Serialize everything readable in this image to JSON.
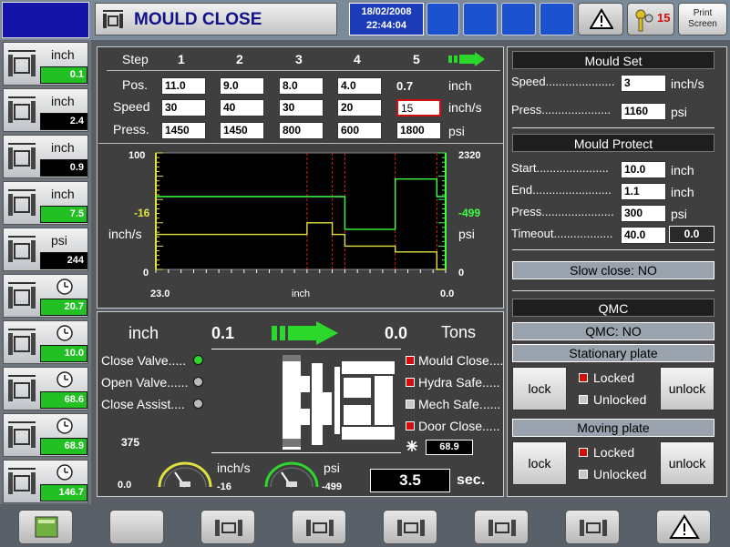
{
  "header": {
    "title": "MOULD CLOSE",
    "date": "18/02/2008",
    "time": "22:44:04",
    "alarm_count": "15",
    "print_label_1": "Print",
    "print_label_2": "Screen"
  },
  "sidebar": [
    {
      "unit": "inch",
      "value": "0.1",
      "color": "#22c022",
      "icon": "clamp-open-icon"
    },
    {
      "unit": "inch",
      "value": "2.4",
      "color": "#000000",
      "icon": "injection-unit-icon"
    },
    {
      "unit": "inch",
      "value": "0.9",
      "color": "#000000",
      "icon": "nozzle-icon"
    },
    {
      "unit": "inch",
      "value": "7.5",
      "color": "#22c022",
      "icon": "screw-back-icon"
    },
    {
      "unit": "psi",
      "value": "244",
      "color": "#000000",
      "icon": "pressure-gauge-icon"
    },
    {
      "unit": "",
      "value": "20.7",
      "color": "#22c022",
      "icon": "screw-timer-icon"
    },
    {
      "unit": "",
      "value": "10.0",
      "color": "#22c022",
      "icon": "cool-timer-icon"
    },
    {
      "unit": "",
      "value": "68.6",
      "color": "#22c022",
      "icon": "rotate-timer-icon"
    },
    {
      "unit": "",
      "value": "68.9",
      "color": "#22c022",
      "icon": "clamp-timer-icon"
    },
    {
      "unit": "",
      "value": "146.7",
      "color": "#22c022",
      "icon": "cycle-timer-icon"
    }
  ],
  "steps": {
    "step_label": "Step",
    "numbers": [
      "1",
      "2",
      "3",
      "4",
      "5"
    ],
    "pos_label": "Pos.",
    "pos_values": [
      "11.0",
      "9.0",
      "8.0",
      "4.0"
    ],
    "pos_last": "0.7",
    "pos_unit": "inch",
    "speed_label": "Speed",
    "speed_values": [
      "30",
      "40",
      "30",
      "20",
      "15"
    ],
    "speed_unit": "inch/s",
    "press_label": "Press.",
    "press_values": [
      "1450",
      "1450",
      "800",
      "600",
      "1800"
    ],
    "press_unit": "psi"
  },
  "chart": {
    "y_left_top": "100",
    "y_left_mid": "-16",
    "y_left_bottom": "0",
    "y_left_unit": "inch/s",
    "y_right_top": "2320",
    "y_right_mid": "-499",
    "y_right_bottom": "0",
    "y_right_unit": "psi",
    "x_left": "23.0",
    "x_unit": "inch",
    "x_right": "0.0"
  },
  "chart_data": {
    "type": "line",
    "x_range": [
      23.0,
      0.0
    ],
    "y_left_range": [
      0,
      100
    ],
    "y_right_range": [
      0,
      2320
    ],
    "series": [
      {
        "axis": "left",
        "color": "#e0e040",
        "x": [
          23.0,
          11.0,
          11.0,
          9.0,
          9.0,
          8.0,
          8.0,
          4.0,
          4.0,
          0.7,
          0.7,
          0.0
        ],
        "values": [
          30,
          30,
          40,
          40,
          30,
          30,
          20,
          20,
          15,
          15,
          0,
          0
        ]
      },
      {
        "axis": "right",
        "color": "#40ff40",
        "x": [
          23.0,
          11.0,
          11.0,
          8.0,
          8.0,
          4.0,
          4.0,
          0.7,
          0.7,
          0.0
        ],
        "values": [
          1450,
          1450,
          1450,
          1450,
          800,
          800,
          1800,
          1800,
          1450,
          1450
        ]
      }
    ]
  },
  "status": {
    "pos_unit": "inch",
    "pos_value": "0.1",
    "force_value": "0.0",
    "force_unit": "Tons",
    "close_valve": "Close Valve.....",
    "open_valve": "Open Valve......",
    "close_assist": "Close Assist....",
    "left_num": "375",
    "left_zero": "0.0",
    "speed_gauge_unit": "inch/s",
    "speed_gauge_value": "-16",
    "press_gauge_unit": "psi",
    "press_gauge_value": "-499",
    "mould_close": "Mould Close....",
    "hydra_safe": "Hydra Safe.....",
    "mech_safe": "Mech Safe......",
    "door_close": "Door Close.....",
    "temp_value": "68.9",
    "time_value": "3.5",
    "time_unit": "sec."
  },
  "mould_set": {
    "title": "Mould Set",
    "speed_label": "Speed.....................",
    "speed_value": "3",
    "speed_unit": "inch/s",
    "press_label": "Press.....................",
    "press_value": "1160",
    "press_unit": "psi"
  },
  "mould_protect": {
    "title": "Mould Protect",
    "start_label": "Start......................",
    "start_value": "10.0",
    "start_unit": "inch",
    "end_label": "End........................",
    "end_value": "1.1",
    "end_unit": "inch",
    "press_label": "Press......................",
    "press_value": "300",
    "press_unit": "psi",
    "timeout_label": "Timeout..................",
    "timeout_value": "40.0",
    "timeout_actual": "0.0",
    "slow_close": "Slow close: NO"
  },
  "qmc": {
    "title": "QMC",
    "status": "QMC: NO",
    "stationary": "Stationary plate",
    "moving": "Moving plate",
    "lock": "lock",
    "unlock": "unlock",
    "locked": "Locked",
    "unlocked": "Unlocked"
  },
  "bottom": [
    "manual-icon",
    "blank-button",
    "mould-close-icon",
    "injection-icon",
    "ejector-icon",
    "core-icon",
    "carriage-icon",
    "warning-icon"
  ]
}
